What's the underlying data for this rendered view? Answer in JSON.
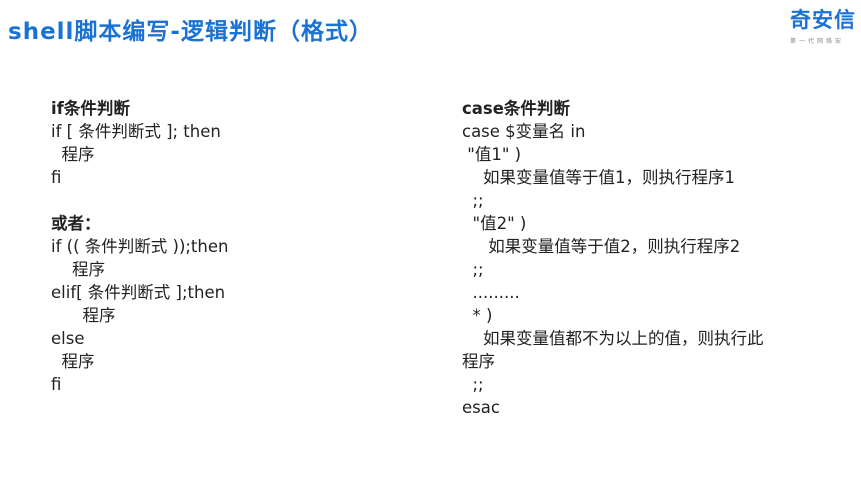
{
  "title": "shell脚本编写-逻辑判断（格式）",
  "logo": {
    "text": "奇安信",
    "tagline": "第一代网络安"
  },
  "left_column": {
    "lines": [
      {
        "text": "if条件判断",
        "bold": true
      },
      {
        "text": "if [ 条件判断式 ]; then",
        "bold": false
      },
      {
        "text": "  程序",
        "bold": false
      },
      {
        "text": "fi",
        "bold": false
      },
      {
        "text": "",
        "bold": false
      },
      {
        "text": "或者：",
        "bold": true
      },
      {
        "text": "if (( 条件判断式 ));then",
        "bold": false
      },
      {
        "text": "    程序",
        "bold": false
      },
      {
        "text": "elif[ 条件判断式 ];then",
        "bold": false
      },
      {
        "text": "      程序",
        "bold": false
      },
      {
        "text": "else",
        "bold": false
      },
      {
        "text": "  程序",
        "bold": false
      },
      {
        "text": "fi",
        "bold": false
      }
    ]
  },
  "right_column": {
    "lines": [
      {
        "text": "case条件判断",
        "bold": true
      },
      {
        "text": "case $变量名 in",
        "bold": false
      },
      {
        "text": " \"值1\" )",
        "bold": false
      },
      {
        "text": "    如果变量值等于值1，则执行程序1",
        "bold": false
      },
      {
        "text": "  ;;",
        "bold": false
      },
      {
        "text": "  \"值2\" )",
        "bold": false
      },
      {
        "text": "     如果变量值等于值2，则执行程序2",
        "bold": false
      },
      {
        "text": "  ;;",
        "bold": false
      },
      {
        "text": "  .........",
        "bold": false
      },
      {
        "text": "  * )",
        "bold": false
      },
      {
        "text": "    如果变量值都不为以上的值，则执行此",
        "bold": false
      },
      {
        "text": "程序",
        "bold": false
      },
      {
        "text": "  ;;",
        "bold": false
      },
      {
        "text": "esac",
        "bold": false
      }
    ]
  }
}
